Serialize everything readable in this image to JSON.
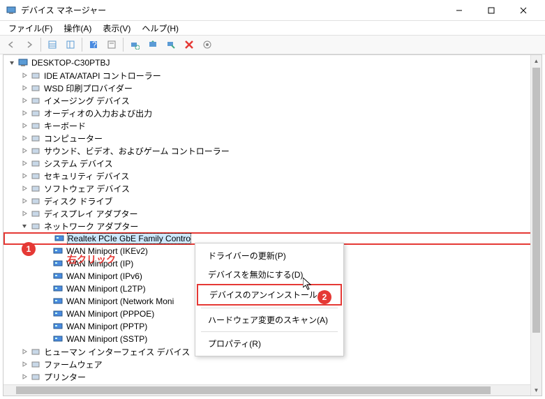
{
  "window": {
    "title": "デバイス マネージャー"
  },
  "menu": {
    "file": "ファイル(F)",
    "action": "操作(A)",
    "view": "表示(V)",
    "help": "ヘルプ(H)"
  },
  "tree": {
    "root": "DESKTOP-C30PTBJ",
    "categories": [
      "IDE ATA/ATAPI コントローラー",
      "WSD 印刷プロバイダー",
      "イメージング デバイス",
      "オーディオの入力および出力",
      "キーボード",
      "コンピューター",
      "サウンド、ビデオ、およびゲーム コントローラー",
      "システム デバイス",
      "セキュリティ デバイス",
      "ソフトウェア デバイス",
      "ディスク ドライブ",
      "ディスプレイ アダプター",
      "ネットワーク アダプター"
    ],
    "network_children": [
      "Realtek PCIe GbE Family Contro",
      "WAN Miniport (IKEv2)",
      "WAN Miniport (IP)",
      "WAN Miniport (IPv6)",
      "WAN Miniport (L2TP)",
      "WAN Miniport (Network Moni",
      "WAN Miniport (PPPOE)",
      "WAN Miniport (PPTP)",
      "WAN Miniport (SSTP)"
    ],
    "categories_after": [
      "ヒューマン インターフェイス デバイス",
      "ファームウェア",
      "プリンター"
    ]
  },
  "context_menu": {
    "update": "ドライバーの更新(P)",
    "disable": "デバイスを無効にする(D)",
    "uninstall": "デバイスのアンインストール(U)",
    "scan": "ハードウェア変更のスキャン(A)",
    "properties": "プロパティ(R)"
  },
  "annotations": {
    "badge1": "1",
    "badge2": "2",
    "rightclick": "右クリック"
  }
}
